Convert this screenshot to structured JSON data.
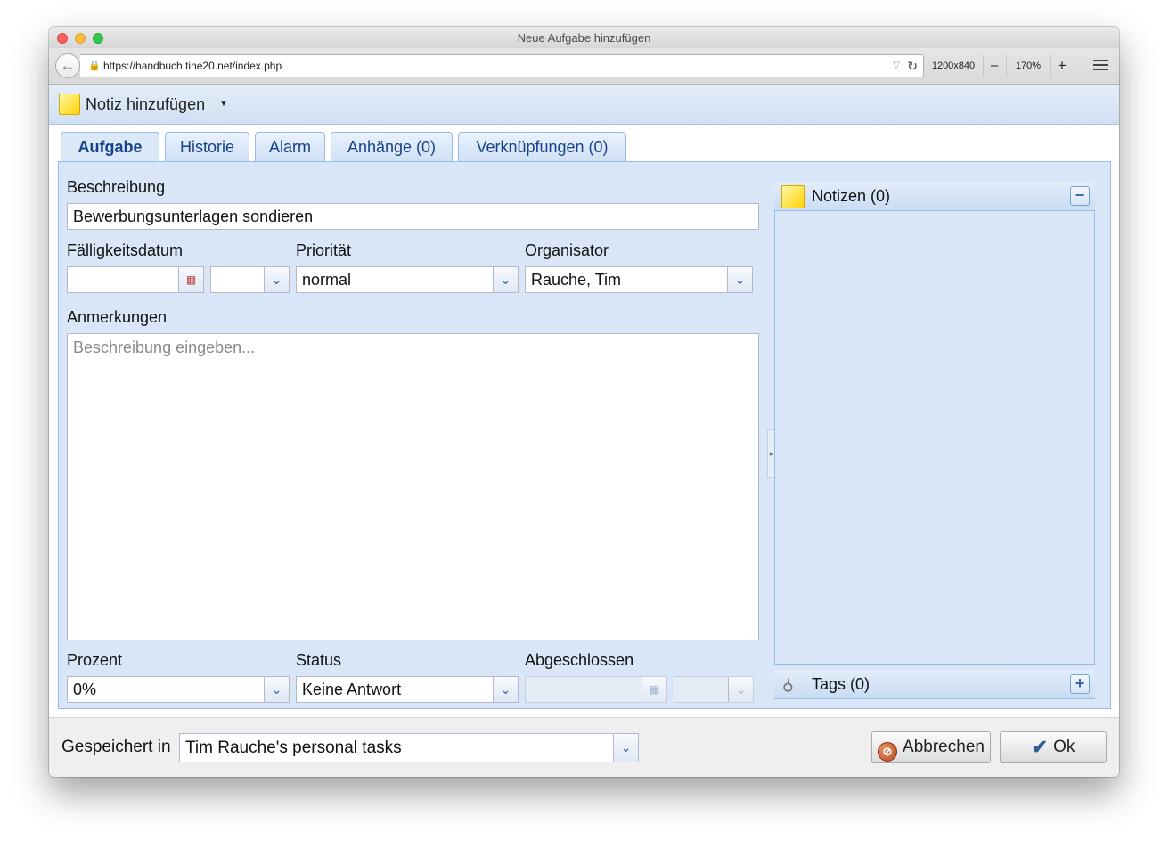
{
  "window": {
    "title": "Neue Aufgabe hinzufügen"
  },
  "browser": {
    "url": "https://handbuch.tine20.net/index.php",
    "resolution": "1200x840",
    "zoom_out": "–",
    "zoom": "170%",
    "zoom_in": "+"
  },
  "toolbar": {
    "add_note_label": "Notiz hinzufügen"
  },
  "tabs": [
    {
      "label": "Aufgabe",
      "active": true
    },
    {
      "label": "Historie"
    },
    {
      "label": "Alarm"
    },
    {
      "label": "Anhänge (0)"
    },
    {
      "label": "Verknüpfungen (0)"
    }
  ],
  "form": {
    "description_label": "Beschreibung",
    "description_value": "Bewerbungsunterlagen sondieren",
    "due_label": "Fälligkeitsdatum",
    "due_date_value": "",
    "due_time_value": "",
    "priority_label": "Priorität",
    "priority_value": "normal",
    "organizer_label": "Organisator",
    "organizer_value": "Rauche, Tim",
    "notes_label": "Anmerkungen",
    "notes_placeholder": "Beschreibung eingeben...",
    "percent_label": "Prozent",
    "percent_value": "0%",
    "status_label": "Status",
    "status_value": "Keine Antwort",
    "completed_label": "Abgeschlossen",
    "completed_date_value": "",
    "completed_time_value": ""
  },
  "side": {
    "notes_title": "Notizen (0)",
    "tags_title": "Tags (0)"
  },
  "footer": {
    "saved_in_label": "Gespeichert in",
    "container_value": "Tim Rauche's personal tasks",
    "cancel_label": "Abbrechen",
    "ok_label": "Ok"
  }
}
